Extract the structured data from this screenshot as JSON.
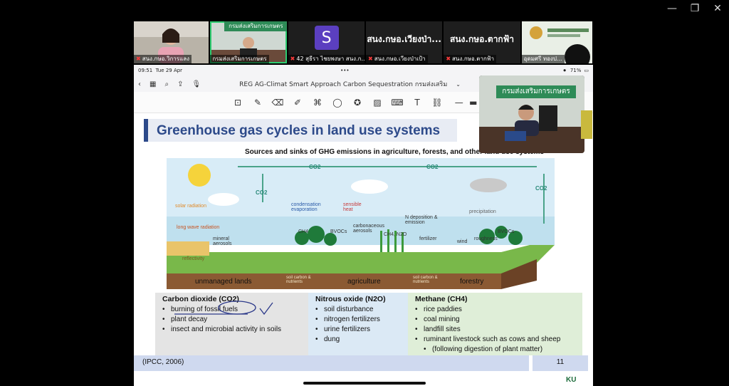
{
  "window": {
    "minimize": "—",
    "restore": "❐",
    "close": "✕"
  },
  "participants": [
    {
      "name": "สนง.กษอ.วิการแลง",
      "type": "video"
    },
    {
      "name": "กรมส่งเสริมการเกษตร",
      "banner": "กรมส่งเสริมการเกษตร",
      "type": "video",
      "speaking": true
    },
    {
      "name": "42 สุธีรา ไชยพงษา สนง.ก...",
      "avatar": "S",
      "type": "avatar"
    },
    {
      "name": "สนง.กษอ.เวียงป่าเป้า",
      "label": "สนง.กษอ.เวียงป่า...",
      "type": "text"
    },
    {
      "name": "สนง.กษอ.ตากฟ้า",
      "label": "สนง.กษอ.ตากฟ้า",
      "type": "text"
    },
    {
      "name": "อุดมศรี ทองป...",
      "type": "video"
    }
  ],
  "ipad": {
    "time": "09:51",
    "date": "Tue 29 Apr",
    "battery": "71%",
    "doc_title": "REG AG-Climat Smart Approach Carbon Sequestration กรมส่งเสริม",
    "dots": "•••"
  },
  "slide": {
    "title": "Greenhouse gas cycles in land use systems",
    "diagram_title": "Sources and sinks of GHG emissions in agriculture, forests, and other land use systems",
    "diagram_labels": {
      "co2": "CO2",
      "solar": "solar radiation",
      "long_wave": "long wave radiation",
      "condensation": "condensation evaporation",
      "sensible": "sensible heat",
      "precipitation": "precipitation",
      "mineral": "mineral aerosols",
      "carbonaceous": "carbonaceous aerosols",
      "n_dep": "N deposition & emission",
      "reflectivity": "reflectivity",
      "bvocs": "BVOCs",
      "ch4": "CH4",
      "ch4n2o": "CH4, N2O",
      "fertilizer": "fertilizer",
      "wind": "wind",
      "roughness": "roughness",
      "soil_carbon": "soil carbon & nutrients"
    },
    "land_uses": [
      "unmanaged lands",
      "agriculture",
      "forestry"
    ],
    "gases": [
      {
        "name": "Carbon dioxide (CO2)",
        "items": [
          "burning of fossil fuels",
          "plant decay",
          "insect and microbial activity in soils"
        ]
      },
      {
        "name": "Nitrous oxide (N2O)",
        "items": [
          "soil disturbance",
          "nitrogen fertilizers",
          "urine fertilizers",
          "dung"
        ]
      },
      {
        "name": "Methane (CH4)",
        "items": [
          "rice paddies",
          "coal mining",
          "landfill sites",
          "ruminant livestock such as cows and sheep",
          "(following digestion of plant matter)"
        ]
      }
    ],
    "source": "(IPCC, 2006)",
    "page": "11"
  },
  "pip": {
    "banner": "กรมส่งเสริมการเกษตร"
  },
  "logo": "KU",
  "colors": {
    "title": "#2d4a8a",
    "speaking": "#2ecc71",
    "banner": "#2e8b57",
    "footer": "#cfd9ef"
  }
}
